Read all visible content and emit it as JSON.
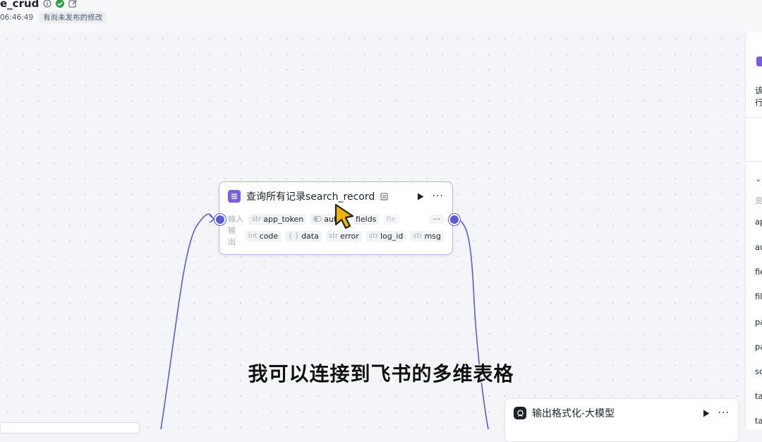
{
  "header": {
    "app_title": "e_crud",
    "saved_time": "06:46:49",
    "unpublished_note": "有尚未发布的修改"
  },
  "node_search": {
    "title": "查询所有记录search_record",
    "input_label": "输入",
    "output_label": "输出",
    "inputs": [
      {
        "type": "str",
        "name": "app_token"
      },
      {
        "type": "",
        "name": "auto"
      },
      {
        "type": "",
        "name": "fields"
      },
      {
        "type": "",
        "name": "fie"
      }
    ],
    "outputs": [
      {
        "type": "int",
        "name": "code"
      },
      {
        "type": "{ }",
        "name": "data"
      },
      {
        "type": "str",
        "name": "error"
      },
      {
        "type": "str",
        "name": "log_id"
      },
      {
        "type": "str",
        "name": "msg"
      }
    ],
    "more": "···"
  },
  "node_format": {
    "title": "输出格式化-大模型"
  },
  "subtitle": "我可以连接到飞书的多维表格",
  "right_panel": {
    "desc_lines": [
      "该",
      "行"
    ],
    "section_label": "变",
    "params": [
      "ap",
      "au",
      "fie",
      "fil",
      "pa",
      "pa",
      "so",
      "ta",
      "ta"
    ]
  },
  "colors": {
    "accent": "#5b5bd6",
    "node_border": "#b7b3f0",
    "icon_purple": "#7c5ce0"
  }
}
